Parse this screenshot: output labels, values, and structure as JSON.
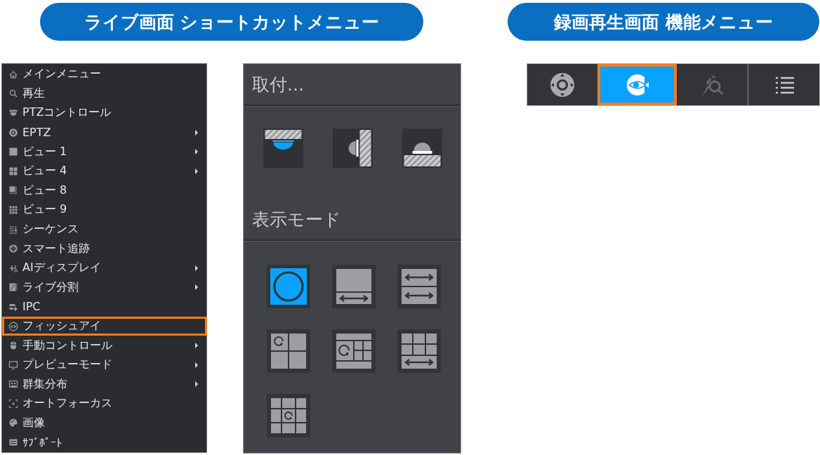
{
  "live_section": {
    "title": "ライブ画面 ショートカットメニュー"
  },
  "shortcut_menu": {
    "items": [
      {
        "kind": "home",
        "label": "メインメニュー",
        "submenu": false,
        "selected": false
      },
      {
        "kind": "search",
        "label": "再生",
        "submenu": false,
        "selected": false
      },
      {
        "kind": "dome",
        "label": "PTZコントロール",
        "submenu": false,
        "selected": false
      },
      {
        "kind": "eptz",
        "label": "EPTZ",
        "submenu": true,
        "selected": false
      },
      {
        "kind": "view1",
        "label": "ビュー 1",
        "submenu": true,
        "selected": false
      },
      {
        "kind": "view4",
        "label": "ビュー 4",
        "submenu": true,
        "selected": false
      },
      {
        "kind": "view8",
        "label": "ビュー 8",
        "submenu": false,
        "selected": false
      },
      {
        "kind": "view9",
        "label": "ビュー 9",
        "submenu": false,
        "selected": false
      },
      {
        "kind": "sequence",
        "label": "シーケンス",
        "submenu": false,
        "selected": false
      },
      {
        "kind": "tracking",
        "label": "スマート追跡",
        "submenu": false,
        "selected": false
      },
      {
        "kind": "ai",
        "label": "AIディスプレイ",
        "submenu": true,
        "selected": false
      },
      {
        "kind": "split",
        "label": "ライブ分割",
        "submenu": true,
        "selected": false
      },
      {
        "kind": "ipc",
        "label": "IPC",
        "submenu": false,
        "selected": false
      },
      {
        "kind": "fisheye",
        "label": "フィッシュアイ",
        "submenu": false,
        "selected": true
      },
      {
        "kind": "mouse",
        "label": "手動コントロール",
        "submenu": true,
        "selected": false
      },
      {
        "kind": "monitor",
        "label": "プレビューモード",
        "submenu": true,
        "selected": false
      },
      {
        "kind": "crowd",
        "label": "群集分布",
        "submenu": true,
        "selected": false
      },
      {
        "kind": "focus",
        "label": "オートフォーカス",
        "submenu": false,
        "selected": false
      },
      {
        "kind": "palette",
        "label": "画像",
        "submenu": false,
        "selected": false
      },
      {
        "kind": "support",
        "label": "ｻﾌﾞﾎﾟｰﾄ",
        "submenu": false,
        "selected": false
      }
    ]
  },
  "fisheye_panel": {
    "mount_title": "取付...",
    "mounts": [
      {
        "kind": "ceiling",
        "selected": false
      },
      {
        "kind": "wall",
        "selected": false
      },
      {
        "kind": "ground",
        "selected": false
      }
    ],
    "mode_title": "表示モード",
    "modes": [
      {
        "kind": "circle",
        "selected": true
      },
      {
        "kind": "panorama",
        "selected": false
      },
      {
        "kind": "double-panorama",
        "selected": false
      },
      {
        "kind": "quad",
        "selected": false
      },
      {
        "kind": "main-six",
        "selected": false
      },
      {
        "kind": "six-panorama",
        "selected": false
      },
      {
        "kind": "nine",
        "selected": false
      }
    ]
  },
  "playback_section": {
    "title": "録画再生画面 機能メニュー"
  },
  "playback_toolbar": [
    {
      "kind": "dpad",
      "selected": false,
      "disabled": false
    },
    {
      "kind": "fisheye",
      "selected": true,
      "disabled": false
    },
    {
      "kind": "pin-search",
      "selected": false,
      "disabled": true
    },
    {
      "kind": "list",
      "selected": false,
      "disabled": false
    }
  ]
}
